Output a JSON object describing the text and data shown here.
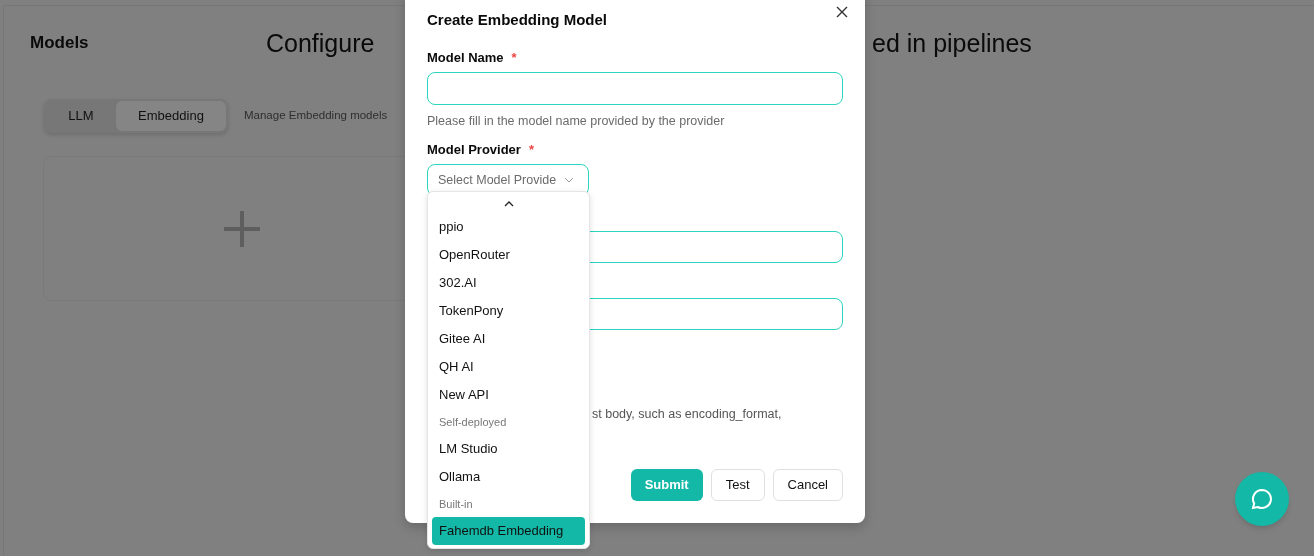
{
  "page": {
    "title": "Models",
    "heading_parts": [
      "Configure",
      "ed in pipelines"
    ],
    "tabs": [
      {
        "label": "LLM",
        "selected": false
      },
      {
        "label": "Embedding",
        "selected": true
      }
    ],
    "description": "Manage Embedding models"
  },
  "dialog": {
    "title": "Create Embedding Model",
    "name_field": {
      "label": "Model Name",
      "required": true,
      "required_mark": "*",
      "helper": "Please fill in the model name provided by the provider"
    },
    "provider_field": {
      "label": "Model Provider",
      "required": true,
      "required_mark": "*",
      "placeholder": "Select Model Provide",
      "open": true
    },
    "hidden_fields": [
      {
        "kind": "input"
      },
      {
        "kind": "input"
      }
    ],
    "partial_text": "st body, such as encoding_format,",
    "buttons": [
      {
        "label": "Submit",
        "kind": "primary"
      },
      {
        "label": "Test",
        "kind": "secondary"
      },
      {
        "label": "Cancel",
        "kind": "secondary"
      }
    ]
  },
  "dropdown": {
    "items": [
      {
        "kind": "option",
        "label": "ppio",
        "selected": false
      },
      {
        "kind": "option",
        "label": "OpenRouter",
        "selected": false
      },
      {
        "kind": "option",
        "label": "302.AI",
        "selected": false
      },
      {
        "kind": "option",
        "label": "TokenPony",
        "selected": false
      },
      {
        "kind": "option",
        "label": "Gitee AI",
        "selected": false
      },
      {
        "kind": "option",
        "label": "QH AI",
        "selected": false
      },
      {
        "kind": "option",
        "label": "New API",
        "selected": false
      },
      {
        "kind": "group",
        "label": "Self-deployed"
      },
      {
        "kind": "option",
        "label": "LM Studio",
        "selected": false
      },
      {
        "kind": "option",
        "label": "Ollama",
        "selected": false
      },
      {
        "kind": "group",
        "label": "Built-in"
      },
      {
        "kind": "option",
        "label": "Fahemdb Embedding",
        "selected": true
      }
    ]
  }
}
